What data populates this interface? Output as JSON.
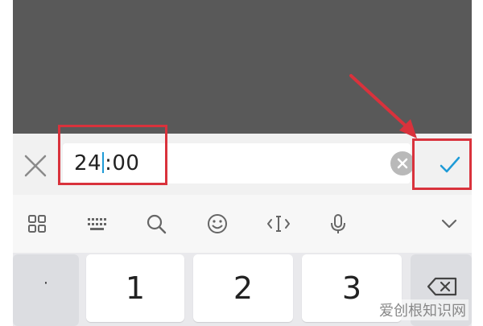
{
  "input_bar": {
    "value": "24:00",
    "value_before_caret": "24",
    "value_after_caret": ":00"
  },
  "toolbar": {
    "icons": [
      "grid-menu-icon",
      "keyboard-icon",
      "search-icon",
      "emoji-icon",
      "cursor-move-icon",
      "microphone-icon",
      "chevron-down-icon"
    ]
  },
  "keyboard": {
    "punct_label": "·",
    "keys": [
      "1",
      "2",
      "3"
    ]
  },
  "watermark": "爱创根知识网",
  "colors": {
    "highlight": "#d9323c",
    "accent": "#1e9bd7"
  }
}
